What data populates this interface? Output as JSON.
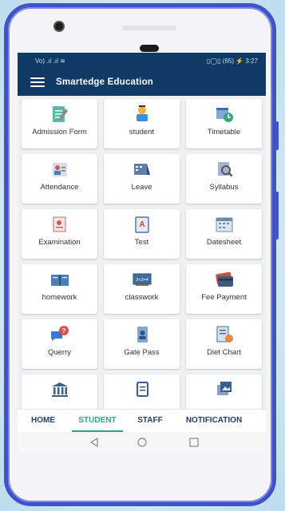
{
  "status_bar": {
    "left": "Vo) .ıl .ıl ≋",
    "right": "▯◯▯ (65) ⚡ 3:27"
  },
  "app_bar": {
    "title": "Smartedge Education"
  },
  "tiles": [
    {
      "label": "Admission Form",
      "icon": "admission-form-icon"
    },
    {
      "label": "student",
      "icon": "student-icon"
    },
    {
      "label": "Timetable",
      "icon": "timetable-icon"
    },
    {
      "label": "Attendance",
      "icon": "attendance-icon"
    },
    {
      "label": "Leave",
      "icon": "leave-icon"
    },
    {
      "label": "Syllabus",
      "icon": "syllabus-icon"
    },
    {
      "label": "Examination",
      "icon": "examination-icon"
    },
    {
      "label": "Test",
      "icon": "test-icon"
    },
    {
      "label": "Datesheet",
      "icon": "datesheet-icon"
    },
    {
      "label": "homework",
      "icon": "homework-icon"
    },
    {
      "label": "classwork",
      "icon": "classwork-icon"
    },
    {
      "label": "Fee Payment",
      "icon": "fee-payment-icon"
    },
    {
      "label": "Querry",
      "icon": "query-icon"
    },
    {
      "label": "Gate Pass",
      "icon": "gate-pass-icon"
    },
    {
      "label": "Diet Chart",
      "icon": "diet-chart-icon"
    },
    {
      "label": "",
      "icon": "bank-icon"
    },
    {
      "label": "",
      "icon": "document-icon"
    },
    {
      "label": "",
      "icon": "gallery-icon"
    }
  ],
  "bottom_nav": [
    {
      "label": "HOME",
      "active": false
    },
    {
      "label": "STUDENT",
      "active": true
    },
    {
      "label": "STAFF",
      "active": false
    },
    {
      "label": "NOTIFICATION",
      "active": false
    }
  ],
  "colors": {
    "app_bar": "#0f3a66",
    "active_tab": "#2aa38f",
    "phone_frame": "#3f52c9"
  }
}
